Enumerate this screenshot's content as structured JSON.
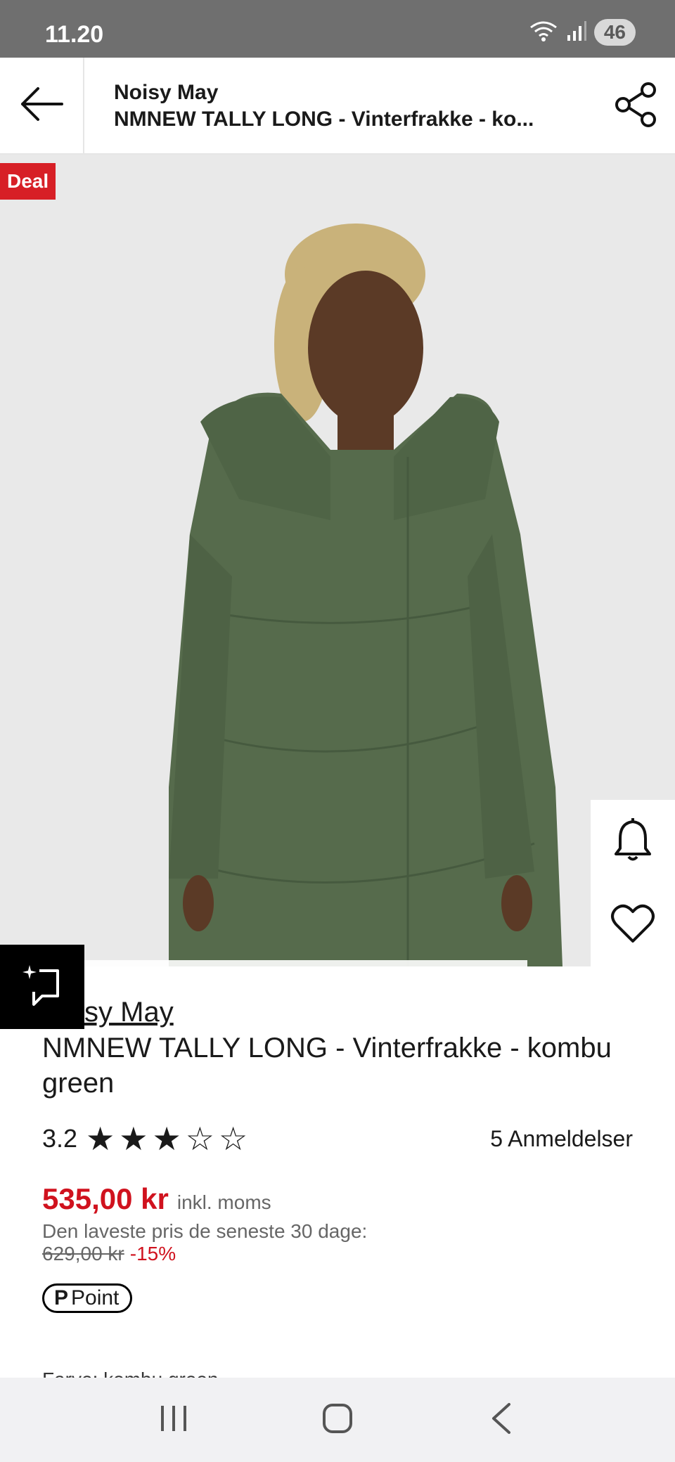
{
  "status": {
    "time": "11.20",
    "battery": "46"
  },
  "header": {
    "brand": "Noisy May",
    "product": "NMNEW TALLY LONG - Vinterfrakke - ko..."
  },
  "image": {
    "deal_badge": "Deal"
  },
  "product": {
    "brand": "Noisy May",
    "title": "NMNEW TALLY LONG - Vinterfrakke - kombu green",
    "rating": "3.2",
    "rating_value": 3.2,
    "stars_filled": 3,
    "stars_total": 5,
    "reviews": "5 Anmeldelser"
  },
  "price": {
    "current": "535,00 kr",
    "vat": "inkl. moms",
    "lowest_label": "Den laveste pris de seneste 30 dage:",
    "old_price": "629,00 kr",
    "discount": "-15%"
  },
  "points": {
    "symbol": "P",
    "label": "Point"
  },
  "color": {
    "label": "Farve: kombu green"
  },
  "colors": {
    "accent_red": "#d0121e",
    "deal_red": "#d71f26",
    "coat_green": "#566b4c"
  },
  "icons": {
    "back": "arrow-left-icon",
    "share": "share-icon",
    "bell": "bell-icon",
    "heart": "heart-icon",
    "ai": "ai-sparkle-icon"
  }
}
